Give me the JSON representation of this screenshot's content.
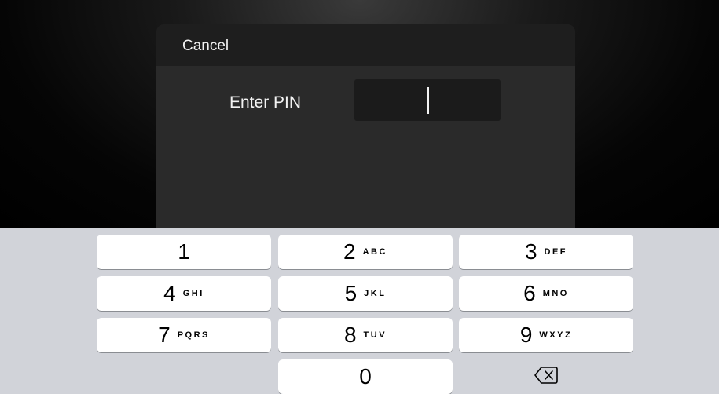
{
  "dialog": {
    "cancel_label": "Cancel",
    "pin_label": "Enter PIN",
    "pin_value": ""
  },
  "keypad": {
    "keys": [
      {
        "digit": "1",
        "letters": ""
      },
      {
        "digit": "2",
        "letters": "ABC"
      },
      {
        "digit": "3",
        "letters": "DEF"
      },
      {
        "digit": "4",
        "letters": "GHI"
      },
      {
        "digit": "5",
        "letters": "JKL"
      },
      {
        "digit": "6",
        "letters": "MNO"
      },
      {
        "digit": "7",
        "letters": "PQRS"
      },
      {
        "digit": "8",
        "letters": "TUV"
      },
      {
        "digit": "9",
        "letters": "WXYZ"
      },
      {
        "digit": "0",
        "letters": ""
      }
    ],
    "delete_icon": "backspace-icon"
  }
}
